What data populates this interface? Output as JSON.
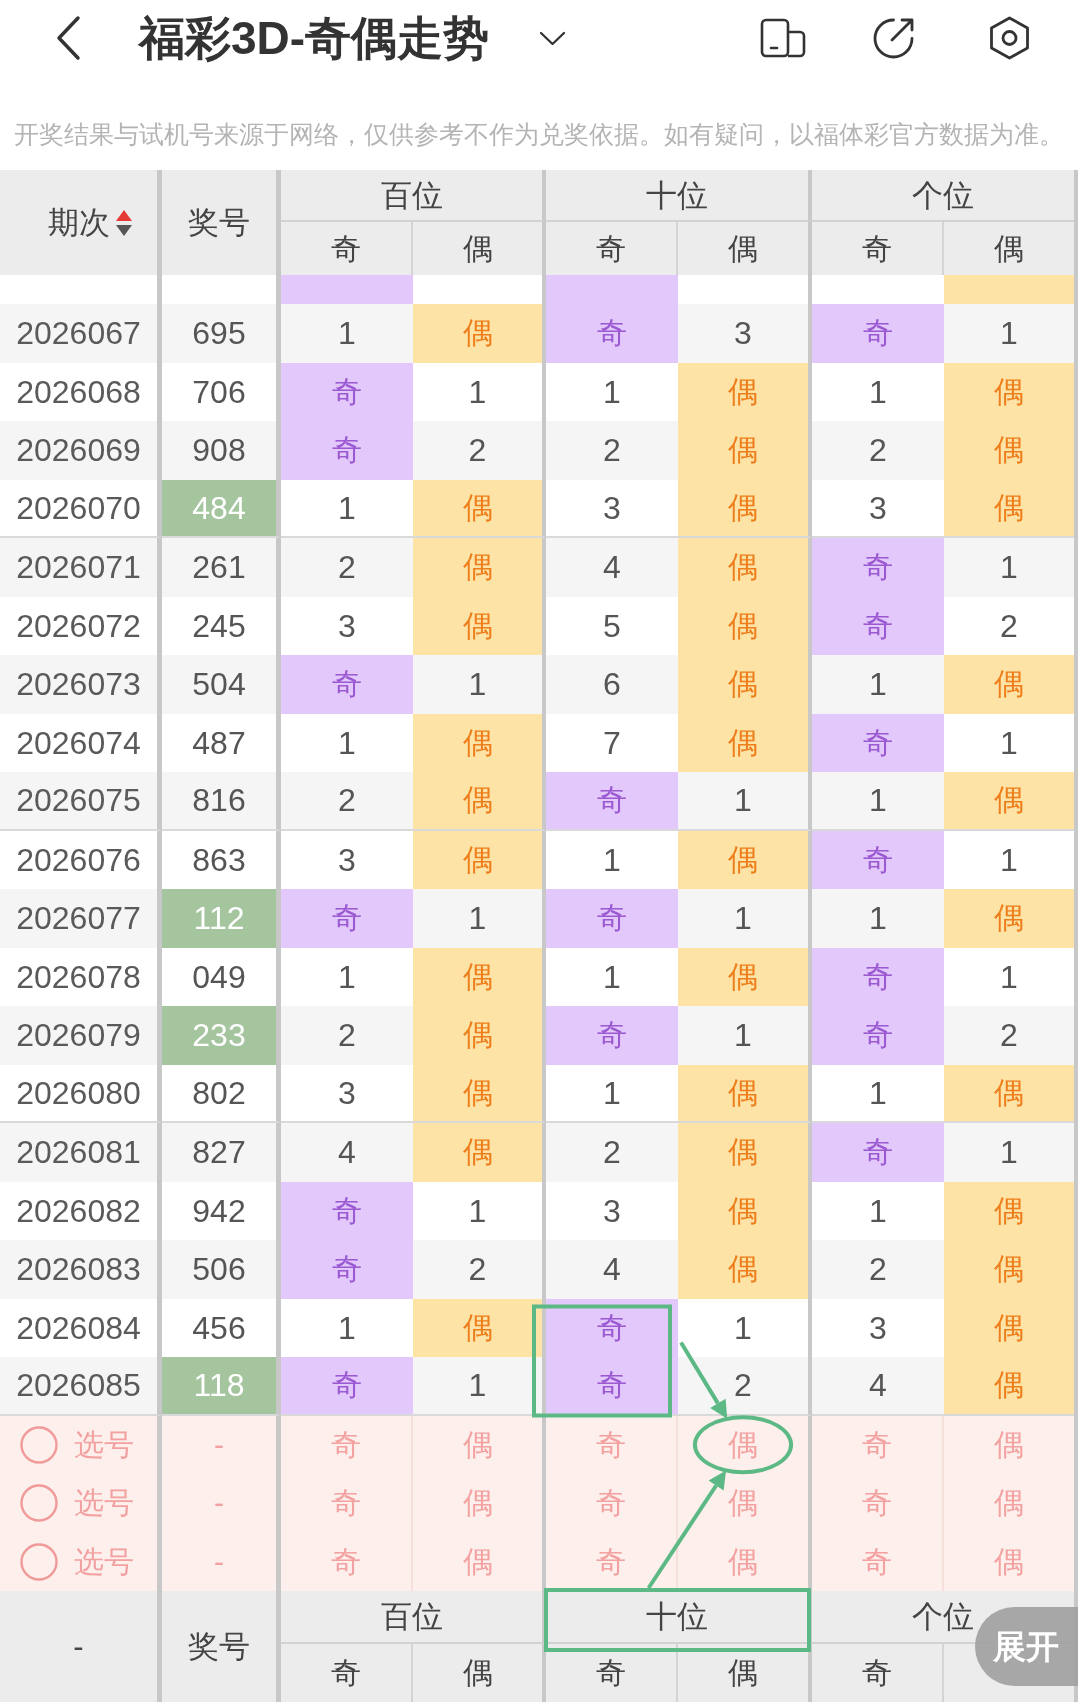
{
  "top_bar": {
    "title": "福彩3D-奇偶走势"
  },
  "disclaimer": "开奖结果与试机号来源于网络，仅供参考不作为兑奖依据。如有疑问，以福体彩官方数据为准。",
  "table": {
    "header": {
      "period": "期次",
      "sorted_ascending": true,
      "number": "奖号",
      "groups": [
        {
          "label": "百位",
          "subs": [
            "奇",
            "偶"
          ]
        },
        {
          "label": "十位",
          "subs": [
            "奇",
            "偶"
          ]
        },
        {
          "label": "个位",
          "subs": [
            "奇",
            "偶"
          ]
        }
      ]
    },
    "cut_row": {
      "cells": [
        {
          "hit": true
        },
        {
          "hit": false
        },
        {
          "hit": true
        },
        {
          "hit": false
        },
        {
          "hit": false
        },
        {
          "hit": true
        }
      ]
    },
    "rows": [
      {
        "period": "2026067",
        "number": "695",
        "highlighted": false,
        "cells": [
          {
            "text": "1",
            "hit": false
          },
          {
            "text": "偶",
            "hit": true
          },
          {
            "text": "奇",
            "hit": true
          },
          {
            "text": "3",
            "hit": false
          },
          {
            "text": "奇",
            "hit": true
          },
          {
            "text": "1",
            "hit": false
          }
        ]
      },
      {
        "period": "2026068",
        "number": "706",
        "highlighted": false,
        "cells": [
          {
            "text": "奇",
            "hit": true
          },
          {
            "text": "1",
            "hit": false
          },
          {
            "text": "1",
            "hit": false
          },
          {
            "text": "偶",
            "hit": true
          },
          {
            "text": "1",
            "hit": false
          },
          {
            "text": "偶",
            "hit": true
          }
        ]
      },
      {
        "period": "2026069",
        "number": "908",
        "highlighted": false,
        "cells": [
          {
            "text": "奇",
            "hit": true
          },
          {
            "text": "2",
            "hit": false
          },
          {
            "text": "2",
            "hit": false
          },
          {
            "text": "偶",
            "hit": true
          },
          {
            "text": "2",
            "hit": false
          },
          {
            "text": "偶",
            "hit": true
          }
        ]
      },
      {
        "period": "2026070",
        "number": "484",
        "highlighted": true,
        "cells": [
          {
            "text": "1",
            "hit": false
          },
          {
            "text": "偶",
            "hit": true
          },
          {
            "text": "3",
            "hit": false
          },
          {
            "text": "偶",
            "hit": true
          },
          {
            "text": "3",
            "hit": false
          },
          {
            "text": "偶",
            "hit": true
          }
        ]
      },
      {
        "period": "2026071",
        "number": "261",
        "highlighted": false,
        "cells": [
          {
            "text": "2",
            "hit": false
          },
          {
            "text": "偶",
            "hit": true
          },
          {
            "text": "4",
            "hit": false
          },
          {
            "text": "偶",
            "hit": true
          },
          {
            "text": "奇",
            "hit": true
          },
          {
            "text": "1",
            "hit": false
          }
        ]
      },
      {
        "period": "2026072",
        "number": "245",
        "highlighted": false,
        "cells": [
          {
            "text": "3",
            "hit": false
          },
          {
            "text": "偶",
            "hit": true
          },
          {
            "text": "5",
            "hit": false
          },
          {
            "text": "偶",
            "hit": true
          },
          {
            "text": "奇",
            "hit": true
          },
          {
            "text": "2",
            "hit": false
          }
        ]
      },
      {
        "period": "2026073",
        "number": "504",
        "highlighted": false,
        "cells": [
          {
            "text": "奇",
            "hit": true
          },
          {
            "text": "1",
            "hit": false
          },
          {
            "text": "6",
            "hit": false
          },
          {
            "text": "偶",
            "hit": true
          },
          {
            "text": "1",
            "hit": false
          },
          {
            "text": "偶",
            "hit": true
          }
        ]
      },
      {
        "period": "2026074",
        "number": "487",
        "highlighted": false,
        "cells": [
          {
            "text": "1",
            "hit": false
          },
          {
            "text": "偶",
            "hit": true
          },
          {
            "text": "7",
            "hit": false
          },
          {
            "text": "偶",
            "hit": true
          },
          {
            "text": "奇",
            "hit": true
          },
          {
            "text": "1",
            "hit": false
          }
        ]
      },
      {
        "period": "2026075",
        "number": "816",
        "highlighted": false,
        "cells": [
          {
            "text": "2",
            "hit": false
          },
          {
            "text": "偶",
            "hit": true
          },
          {
            "text": "奇",
            "hit": true
          },
          {
            "text": "1",
            "hit": false
          },
          {
            "text": "1",
            "hit": false
          },
          {
            "text": "偶",
            "hit": true
          }
        ]
      },
      {
        "period": "2026076",
        "number": "863",
        "highlighted": false,
        "cells": [
          {
            "text": "3",
            "hit": false
          },
          {
            "text": "偶",
            "hit": true
          },
          {
            "text": "1",
            "hit": false
          },
          {
            "text": "偶",
            "hit": true
          },
          {
            "text": "奇",
            "hit": true
          },
          {
            "text": "1",
            "hit": false
          }
        ]
      },
      {
        "period": "2026077",
        "number": "112",
        "highlighted": true,
        "cells": [
          {
            "text": "奇",
            "hit": true
          },
          {
            "text": "1",
            "hit": false
          },
          {
            "text": "奇",
            "hit": true
          },
          {
            "text": "1",
            "hit": false
          },
          {
            "text": "1",
            "hit": false
          },
          {
            "text": "偶",
            "hit": true
          }
        ]
      },
      {
        "period": "2026078",
        "number": "049",
        "highlighted": false,
        "cells": [
          {
            "text": "1",
            "hit": false
          },
          {
            "text": "偶",
            "hit": true
          },
          {
            "text": "1",
            "hit": false
          },
          {
            "text": "偶",
            "hit": true
          },
          {
            "text": "奇",
            "hit": true
          },
          {
            "text": "1",
            "hit": false
          }
        ]
      },
      {
        "period": "2026079",
        "number": "233",
        "highlighted": true,
        "cells": [
          {
            "text": "2",
            "hit": false
          },
          {
            "text": "偶",
            "hit": true
          },
          {
            "text": "奇",
            "hit": true
          },
          {
            "text": "1",
            "hit": false
          },
          {
            "text": "奇",
            "hit": true
          },
          {
            "text": "2",
            "hit": false
          }
        ]
      },
      {
        "period": "2026080",
        "number": "802",
        "highlighted": false,
        "cells": [
          {
            "text": "3",
            "hit": false
          },
          {
            "text": "偶",
            "hit": true
          },
          {
            "text": "1",
            "hit": false
          },
          {
            "text": "偶",
            "hit": true
          },
          {
            "text": "1",
            "hit": false
          },
          {
            "text": "偶",
            "hit": true
          }
        ]
      },
      {
        "period": "2026081",
        "number": "827",
        "highlighted": false,
        "cells": [
          {
            "text": "4",
            "hit": false
          },
          {
            "text": "偶",
            "hit": true
          },
          {
            "text": "2",
            "hit": false
          },
          {
            "text": "偶",
            "hit": true
          },
          {
            "text": "奇",
            "hit": true
          },
          {
            "text": "1",
            "hit": false
          }
        ]
      },
      {
        "period": "2026082",
        "number": "942",
        "highlighted": false,
        "cells": [
          {
            "text": "奇",
            "hit": true
          },
          {
            "text": "1",
            "hit": false
          },
          {
            "text": "3",
            "hit": false
          },
          {
            "text": "偶",
            "hit": true
          },
          {
            "text": "1",
            "hit": false
          },
          {
            "text": "偶",
            "hit": true
          }
        ]
      },
      {
        "period": "2026083",
        "number": "506",
        "highlighted": false,
        "cells": [
          {
            "text": "奇",
            "hit": true
          },
          {
            "text": "2",
            "hit": false
          },
          {
            "text": "4",
            "hit": false
          },
          {
            "text": "偶",
            "hit": true
          },
          {
            "text": "2",
            "hit": false
          },
          {
            "text": "偶",
            "hit": true
          }
        ]
      },
      {
        "period": "2026084",
        "number": "456",
        "highlighted": false,
        "cells": [
          {
            "text": "1",
            "hit": false
          },
          {
            "text": "偶",
            "hit": true
          },
          {
            "text": "奇",
            "hit": true
          },
          {
            "text": "1",
            "hit": false
          },
          {
            "text": "3",
            "hit": false
          },
          {
            "text": "偶",
            "hit": true
          }
        ]
      },
      {
        "period": "2026085",
        "number": "118",
        "highlighted": true,
        "cells": [
          {
            "text": "奇",
            "hit": true
          },
          {
            "text": "1",
            "hit": false
          },
          {
            "text": "奇",
            "hit": true
          },
          {
            "text": "2",
            "hit": false
          },
          {
            "text": "4",
            "hit": false
          },
          {
            "text": "偶",
            "hit": true
          }
        ]
      }
    ],
    "pick_rows": [
      {
        "label": "选号",
        "selected": false,
        "number": "-",
        "options": [
          {
            "text": "奇",
            "selected": false
          },
          {
            "text": "偶",
            "selected": false
          },
          {
            "text": "奇",
            "selected": false
          },
          {
            "text": "偶",
            "selected": false
          },
          {
            "text": "奇",
            "selected": false
          },
          {
            "text": "偶",
            "selected": false
          }
        ]
      },
      {
        "label": "选号",
        "selected": false,
        "number": "-",
        "options": [
          {
            "text": "奇",
            "selected": false
          },
          {
            "text": "偶",
            "selected": false
          },
          {
            "text": "奇",
            "selected": false
          },
          {
            "text": "偶",
            "selected": false
          },
          {
            "text": "奇",
            "selected": false
          },
          {
            "text": "偶",
            "selected": false
          }
        ]
      },
      {
        "label": "选号",
        "selected": false,
        "number": "-",
        "options": [
          {
            "text": "奇",
            "selected": false
          },
          {
            "text": "偶",
            "selected": false
          },
          {
            "text": "奇",
            "selected": false
          },
          {
            "text": "偶",
            "selected": false
          },
          {
            "text": "奇",
            "selected": false
          },
          {
            "text": "偶",
            "selected": false
          }
        ]
      }
    ],
    "footer": {
      "period": "-",
      "number": "奖号",
      "groups": [
        {
          "label": "百位",
          "subs": [
            "奇",
            "偶"
          ]
        },
        {
          "label": "十位",
          "subs": [
            "奇",
            "偶"
          ]
        },
        {
          "label": "个位",
          "subs": [
            "奇"
          ]
        }
      ]
    }
  },
  "expand_button": {
    "label": "展开"
  },
  "annotations": [
    {
      "kind": "box"
    },
    {
      "kind": "ellipse"
    },
    {
      "kind": "box"
    },
    {
      "kind": "arrow"
    },
    {
      "kind": "arrow"
    }
  ]
}
